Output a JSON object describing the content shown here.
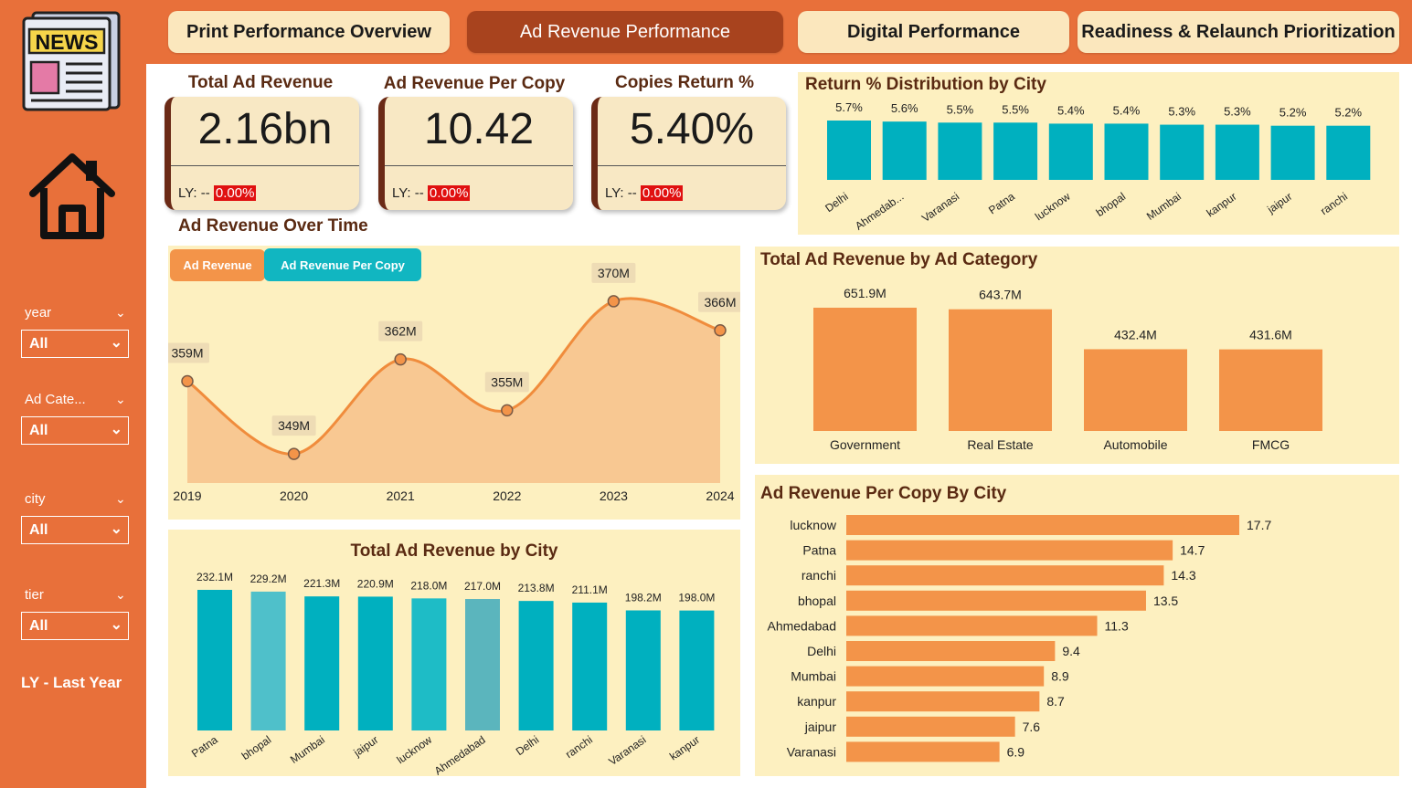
{
  "tabs": [
    {
      "label": "Print Performance Overview",
      "active": false
    },
    {
      "label": "Ad Revenue Performance",
      "active": true
    },
    {
      "label": "Digital Performance",
      "active": false
    },
    {
      "label": "Readiness & Relaunch Prioritization",
      "active": false
    }
  ],
  "sidebar": {
    "logo_text": "NEWS",
    "filters": [
      {
        "label": "year",
        "value": "All"
      },
      {
        "label": "Ad Cate...",
        "value": "All"
      },
      {
        "label": "city",
        "value": "All"
      },
      {
        "label": "tier",
        "value": "All"
      }
    ],
    "footnote": "LY - Last Year"
  },
  "kpis": [
    {
      "title": "Total Ad Revenue",
      "value": "2.16bn",
      "ly_label": "LY: --",
      "ly_pct": "0.00%"
    },
    {
      "title": "Ad  Revenue Per Copy",
      "value": "10.42",
      "ly_label": "LY: --",
      "ly_pct": "0.00%"
    },
    {
      "title": "Copies Return %",
      "value": "5.40%",
      "ly_label": "LY: --",
      "ly_pct": "0.00%"
    }
  ],
  "ad_revenue_over_time": {
    "title": "Ad Revenue Over Time",
    "buttons": [
      "Ad Revenue",
      "Ad Revenue Per Copy"
    ]
  },
  "colors": {
    "teal": "#00b0bf",
    "orange": "#f39449",
    "panel_bg": "#fdf0c0",
    "accent_dark": "#a8431e"
  },
  "chart_data": [
    {
      "id": "return_pct",
      "type": "bar",
      "title": "Return % Distribution by City",
      "categories": [
        "Delhi",
        "Ahmedab...",
        "Varanasi",
        "Patna",
        "lucknow",
        "bhopal",
        "Mumbai",
        "kanpur",
        "jaipur",
        "ranchi"
      ],
      "values": [
        5.7,
        5.6,
        5.5,
        5.5,
        5.4,
        5.4,
        5.3,
        5.3,
        5.2,
        5.2
      ],
      "labels": [
        "5.7%",
        "5.6%",
        "5.5%",
        "5.5%",
        "5.4%",
        "5.4%",
        "5.3%",
        "5.3%",
        "5.2%",
        "5.2%"
      ]
    },
    {
      "id": "revenue_time",
      "type": "area",
      "title": "Ad Revenue Over Time",
      "x": [
        "2019",
        "2020",
        "2021",
        "2022",
        "2023",
        "2024"
      ],
      "values": [
        359,
        349,
        362,
        355,
        370,
        366
      ],
      "labels": [
        "359M",
        "349M",
        "362M",
        "355M",
        "370M",
        "366M"
      ]
    },
    {
      "id": "ad_category",
      "type": "bar",
      "title": "Total Ad Revenue by Ad Category",
      "categories": [
        "Government",
        "Real Estate",
        "Automobile",
        "FMCG"
      ],
      "values": [
        651.9,
        643.7,
        432.4,
        431.6
      ],
      "labels": [
        "651.9M",
        "643.7M",
        "432.4M",
        "431.6M"
      ]
    },
    {
      "id": "revenue_city",
      "type": "bar",
      "title": "Total Ad Revenue by City",
      "categories": [
        "Patna",
        "bhopal",
        "Mumbai",
        "jaipur",
        "lucknow",
        "Ahmedabad",
        "Delhi",
        "ranchi",
        "Varanasi",
        "kanpur"
      ],
      "values": [
        232.1,
        229.2,
        221.3,
        220.9,
        218.0,
        217.0,
        213.8,
        211.1,
        198.2,
        198.0
      ],
      "labels": [
        "232.1M",
        "229.2M",
        "221.3M",
        "220.9M",
        "218.0M",
        "217.0M",
        "213.8M",
        "211.1M",
        "198.2M",
        "198.0M"
      ],
      "bar_colors": [
        "#00b0bf",
        "#4fc0ca",
        "#00b0bf",
        "#00b0bf",
        "#1ebcc6",
        "#5bb5bd",
        "#00b0bf",
        "#00b0bf",
        "#00b0bf",
        "#00b0bf"
      ]
    },
    {
      "id": "per_copy_city",
      "type": "bar",
      "orientation": "horizontal",
      "title": "Ad Revenue Per Copy By City",
      "categories": [
        "lucknow",
        "Patna",
        "ranchi",
        "bhopal",
        "Ahmedabad",
        "Delhi",
        "Mumbai",
        "kanpur",
        "jaipur",
        "Varanasi"
      ],
      "values": [
        17.7,
        14.7,
        14.3,
        13.5,
        11.3,
        9.4,
        8.9,
        8.7,
        7.6,
        6.9
      ],
      "labels": [
        "17.7",
        "14.7",
        "14.3",
        "13.5",
        "11.3",
        "9.4",
        "8.9",
        "8.7",
        "7.6",
        "6.9"
      ]
    }
  ]
}
